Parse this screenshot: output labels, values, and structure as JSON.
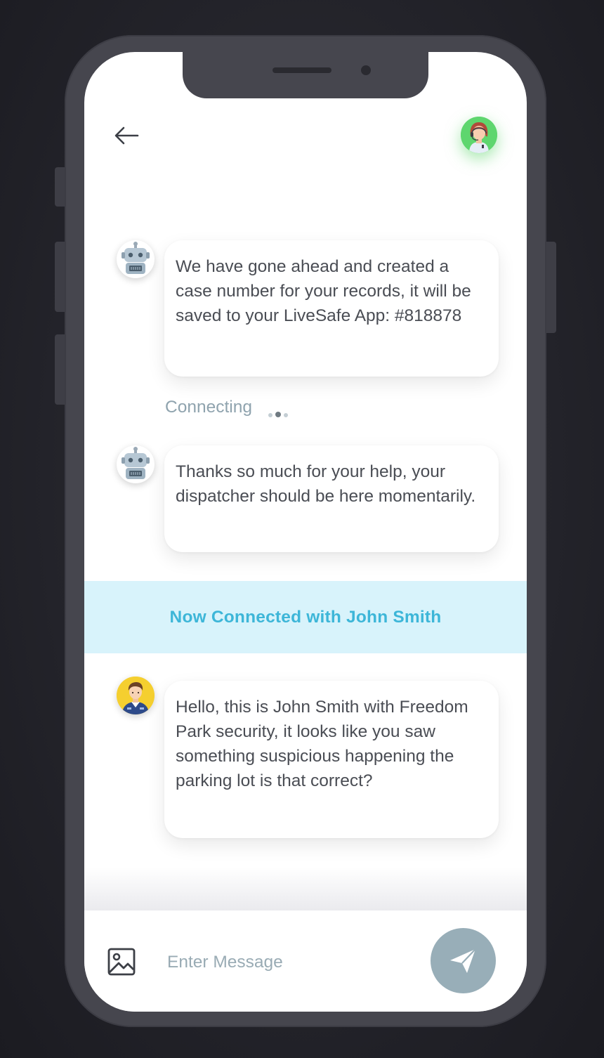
{
  "header": {
    "back_icon": "arrow-left-icon",
    "agent_avatar_icon": "support-agent-headset-avatar"
  },
  "messages": [
    {
      "sender": "bot",
      "avatar_icon": "robot-avatar",
      "text": "We have gone ahead and created a case number for your records, it will be saved to your LiveSafe App: #818878"
    },
    {
      "sender": "bot",
      "avatar_icon": "robot-avatar",
      "text": "Thanks so much for your help, your dispatcher should be here momentarily."
    },
    {
      "sender": "officer",
      "avatar_icon": "security-officer-avatar",
      "text": "Hello, this is John Smith with Freedom Park security, it looks like you saw something suspicious happening the parking lot is that correct?"
    }
  ],
  "status": {
    "connecting_text": "Connecting",
    "banner_text": "Now Connected with John Smith"
  },
  "composer": {
    "placeholder": "Enter Message",
    "image_icon": "image-icon",
    "send_icon": "paper-plane-icon"
  },
  "colors": {
    "banner_bg": "#d8f3fb",
    "banner_text": "#3db6d8",
    "send_button": "#98aeb8",
    "agent_ring": "#5ed66e",
    "phone_frame": "#46464e"
  }
}
